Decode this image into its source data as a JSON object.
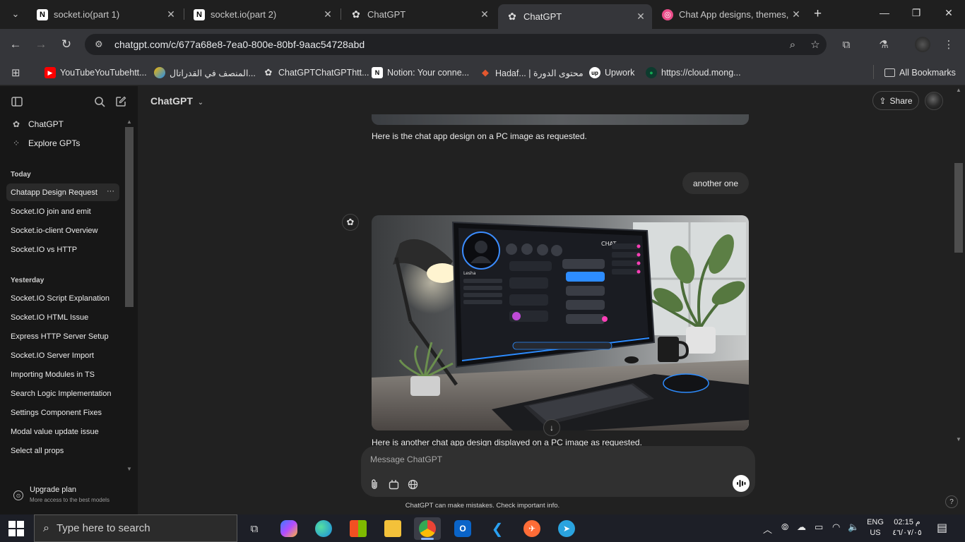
{
  "browser": {
    "tab_search_icon": "chevron-down-icon",
    "tabs": [
      {
        "title": "socket.io(part 1)",
        "icon": "notion-icon"
      },
      {
        "title": "socket.io(part 2)",
        "icon": "notion-icon"
      },
      {
        "title": "ChatGPT",
        "icon": "openai-icon"
      },
      {
        "title": "ChatGPT",
        "icon": "openai-icon",
        "active": true
      },
      {
        "title": "Chat App designs, themes, te",
        "icon": "dribbble-icon"
      }
    ],
    "new_tab": "+",
    "window_controls": {
      "minimize": "—",
      "restore": "❐",
      "close": "✕"
    },
    "url": "chatgpt.com/c/677a68e8-7ea0-800e-80bf-9aac54728abd",
    "bookmarks": [
      {
        "label": "YouTubeYouTubehtt...",
        "icon": "youtube-icon"
      },
      {
        "label": "المنصف في القدراتال...",
        "icon": "platform-icon"
      },
      {
        "label": "ChatGPTChatGPThtt...",
        "icon": "openai-icon"
      },
      {
        "label": "Notion: Your conne...",
        "icon": "notion-icon"
      },
      {
        "label": "Hadaf... | محتوى الدورة",
        "icon": "hadaf-icon"
      },
      {
        "label": "Upwork",
        "icon": "upwork-icon"
      },
      {
        "label": "https://cloud.mong...",
        "icon": "mongodb-icon"
      }
    ],
    "all_bookmarks": "All Bookmarks"
  },
  "sidebar": {
    "top_items": [
      {
        "label": "ChatGPT",
        "icon": "openai-icon"
      },
      {
        "label": "Explore GPTs",
        "icon": "grid-icon"
      }
    ],
    "today_label": "Today",
    "today": [
      "Chatapp Design Request",
      "Socket.IO join and emit",
      "Socket.io-client Overview",
      "Socket.IO vs HTTP"
    ],
    "more_dots": "···",
    "yesterday_label": "Yesterday",
    "yesterday": [
      "Socket.IO Script Explanation",
      "Socket.IO HTML Issue",
      "Express HTTP Server Setup",
      "Socket.IO Server Import",
      "Importing Modules in TS",
      "Search Logic Implementation",
      "Settings Component Fixes",
      "Modal value update issue",
      "Select all props"
    ],
    "upgrade": {
      "title": "Upgrade plan",
      "subtitle": "More access to the best models"
    }
  },
  "main": {
    "model": "ChatGPT",
    "share": "Share",
    "messages": {
      "first_caption": "Here is the chat app design on a PC image as requested.",
      "user_message": "another one",
      "second_caption": "Here is another chat app design displayed on a PC image as requested."
    },
    "image_screen": {
      "title": "CHAT",
      "user_name": "Lesha"
    },
    "composer_placeholder": "Message ChatGPT",
    "disclaimer": "ChatGPT can make mistakes. Check important info.",
    "help": "?"
  },
  "taskbar": {
    "search_placeholder": "Type here to search",
    "apps": [
      "task-view-icon",
      "copilot-icon",
      "edge-icon",
      "store-icon",
      "file-explorer-icon",
      "chrome-icon",
      "outlook-icon",
      "vscode-icon",
      "postman-icon",
      "telegram-icon"
    ],
    "lang_top": "ENG",
    "lang_bottom": "US",
    "time": "02:15 م",
    "date": "٤٦/٠٧/٠٥"
  },
  "colors": {
    "sidebar_bg": "#171717",
    "main_bg": "#212121",
    "composer_bg": "#303030",
    "accent_blue": "#2d8cff",
    "accent_pink": "#ff3fb8"
  }
}
